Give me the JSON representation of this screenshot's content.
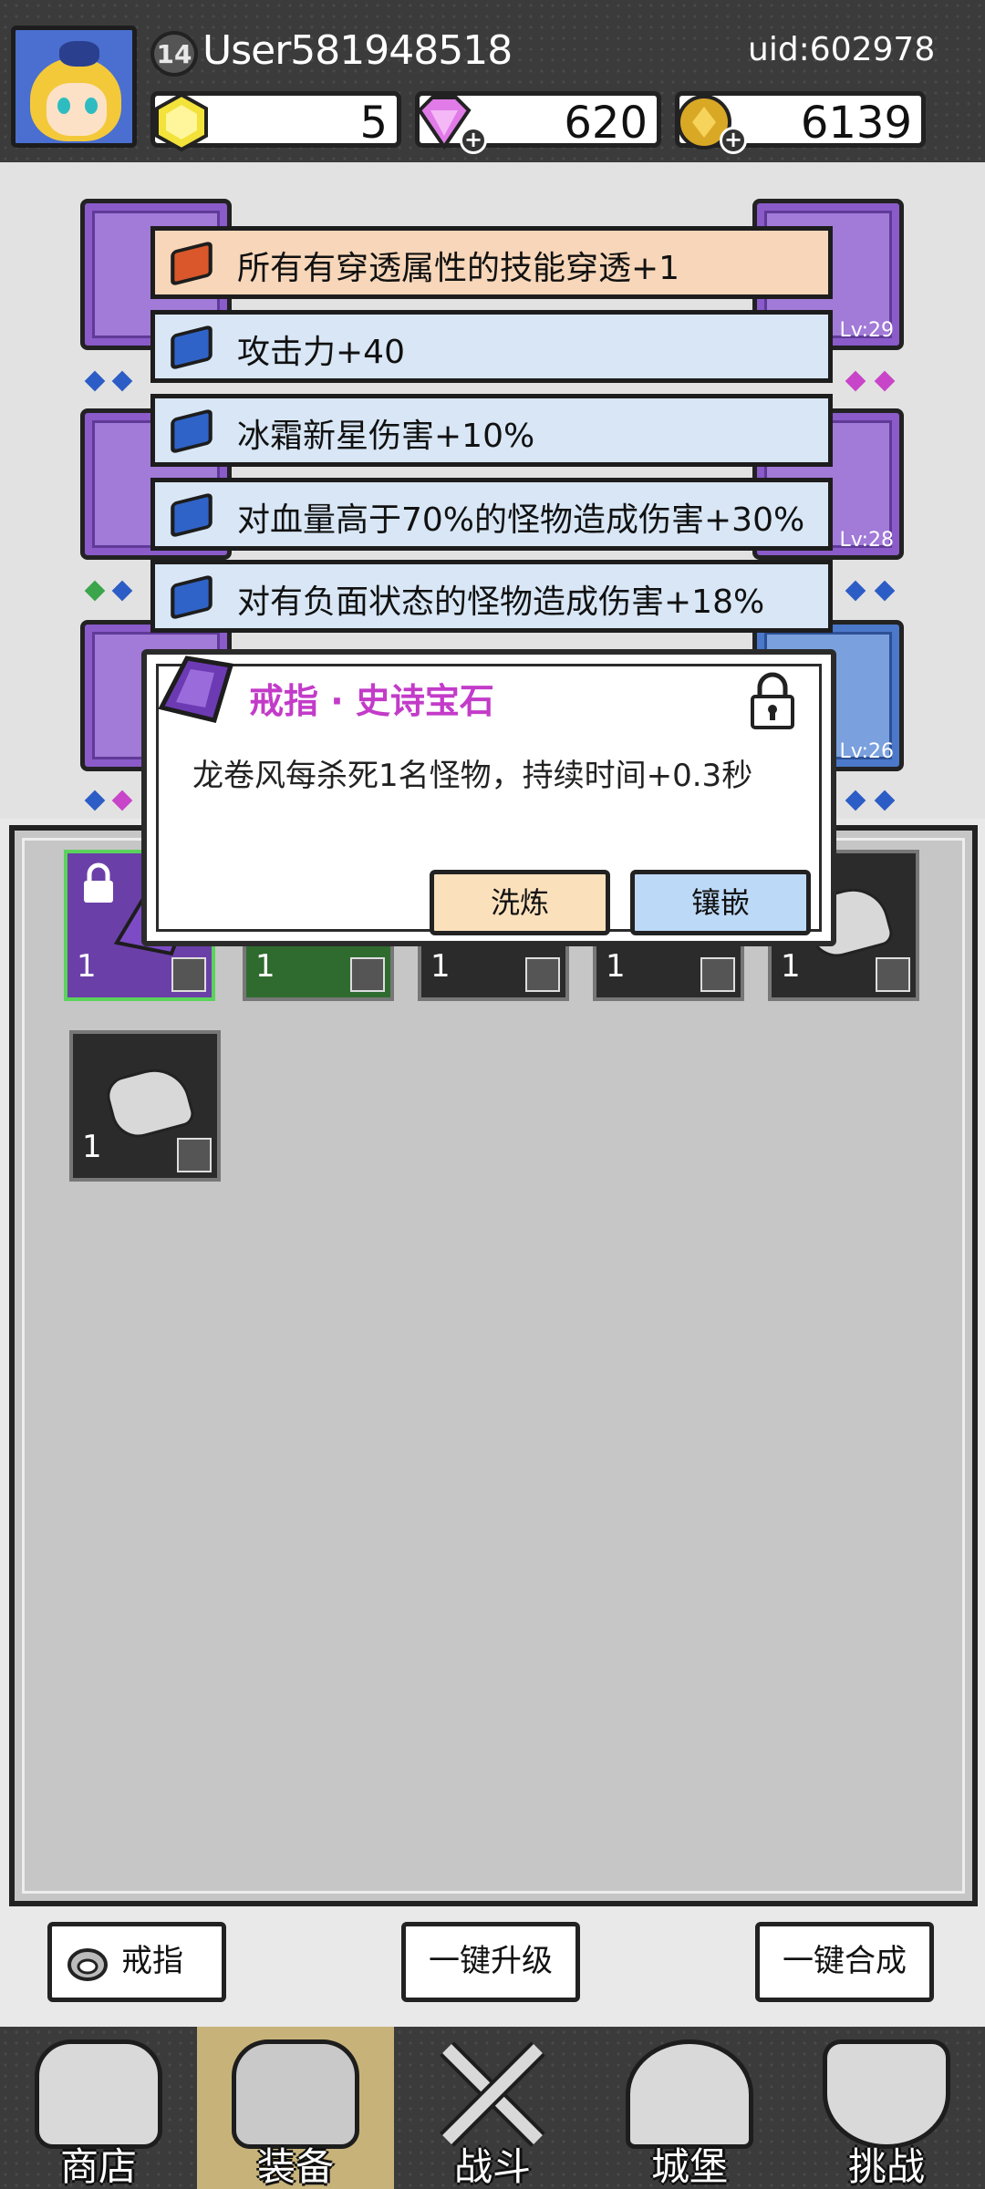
{
  "header": {
    "level": "14",
    "username": "User581948518",
    "uid": "uid:602978",
    "resources": [
      {
        "icon": "gold-gem-icon",
        "value": "5"
      },
      {
        "icon": "purple-diamond-icon",
        "value": "620"
      },
      {
        "icon": "gold-coin-icon",
        "value": "6139"
      }
    ]
  },
  "equipment": {
    "slot_levels": [
      "Lv:29",
      "Lv:28",
      "Lv:26"
    ]
  },
  "affixes": [
    "所有有穿透属性的技能穿透+1",
    "攻击力+40",
    "冰霜新星伤害+10%",
    "对血量高于70%的怪物造成伤害+30%",
    "对有负面状态的怪物造成伤害+18%"
  ],
  "popup": {
    "title": "戒指 · 史诗宝石",
    "description": "龙卷风每杀死1名怪物，持续时间+0.3秒",
    "refine_label": "洗炼",
    "inlay_label": "镶嵌"
  },
  "inventory": {
    "items": [
      {
        "count": "1",
        "kind": "purple-gem"
      },
      {
        "count": "1",
        "kind": "green-gem"
      },
      {
        "count": "1",
        "kind": "stone"
      },
      {
        "count": "1",
        "kind": "stone"
      },
      {
        "count": "1",
        "kind": "stone"
      },
      {
        "count": "1",
        "kind": "stone"
      }
    ]
  },
  "actions": {
    "filter_label": "戒指",
    "upgrade_all_label": "一键升级",
    "merge_all_label": "一键合成"
  },
  "nav": {
    "tabs": [
      "商店",
      "装备",
      "战斗",
      "城堡",
      "挑战"
    ],
    "active": "装备"
  },
  "colors": {
    "epic_purple": "#c33bc9",
    "refine_button": "#fbe0bc",
    "inlay_button": "#bcd9f7"
  }
}
